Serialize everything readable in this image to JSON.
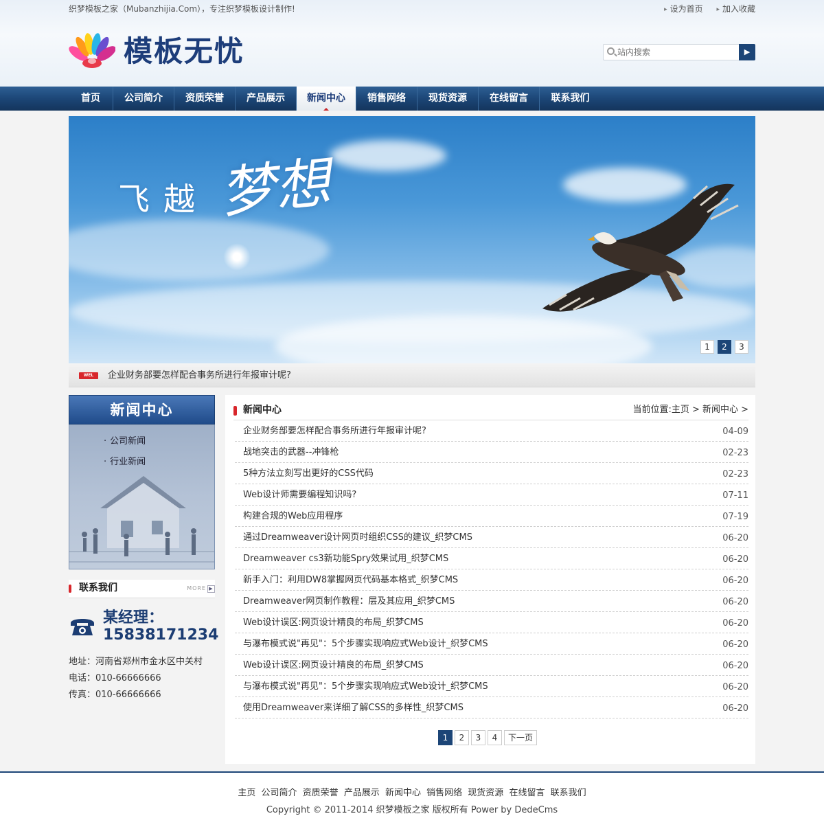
{
  "topbar": {
    "slogan": "织梦模板之家（Mubanzhijia.Com），专注织梦模板设计制作!",
    "links": [
      "设为首页",
      "加入收藏"
    ]
  },
  "logo": {
    "text": "模板无忧"
  },
  "search": {
    "placeholder": "站内搜索"
  },
  "nav": {
    "items": [
      "首页",
      "公司简介",
      "资质荣誉",
      "产品展示",
      "新闻中心",
      "销售网络",
      "现货资源",
      "在线留言",
      "联系我们"
    ],
    "active": "新闻中心"
  },
  "banner": {
    "title1": "飞越",
    "title2": "梦想",
    "slides": [
      "1",
      "2",
      "3"
    ],
    "active_slide": "2"
  },
  "ticker": {
    "badge": "WEL",
    "text": "企业财务部要怎样配合事务所进行年报审计呢?"
  },
  "sidebar": {
    "title": "新闻中心",
    "items": [
      "公司新闻",
      "行业新闻"
    ]
  },
  "contact": {
    "title": "联系我们",
    "more": "MORE",
    "manager": "某经理：",
    "phone": "15838171234",
    "address": "地址：河南省郑州市金水区中关村",
    "tel": "电话：010-66666666",
    "fax": "传真：010-66666666"
  },
  "main": {
    "title": "新闻中心",
    "breadcrumb": "当前位置:主页 > 新闻中心 >",
    "news": [
      {
        "title": "企业财务部要怎样配合事务所进行年报审计呢?",
        "date": "04-09"
      },
      {
        "title": "战地突击的武器--冲锋枪",
        "date": "02-23"
      },
      {
        "title": "5种方法立刻写出更好的CSS代码",
        "date": "02-23"
      },
      {
        "title": "Web设计师需要编程知识吗?",
        "date": "07-11"
      },
      {
        "title": "构建合规的Web应用程序",
        "date": "07-19"
      },
      {
        "title": "通过Dreamweaver设计网页时组织CSS的建议_织梦CMS",
        "date": "06-20"
      },
      {
        "title": "Dreamweaver cs3新功能Spry效果试用_织梦CMS",
        "date": "06-20"
      },
      {
        "title": "新手入门：利用DW8掌握网页代码基本格式_织梦CMS",
        "date": "06-20"
      },
      {
        "title": "Dreamweaver网页制作教程：层及其应用_织梦CMS",
        "date": "06-20"
      },
      {
        "title": "Web设计误区:网页设计精良的布局_织梦CMS",
        "date": "06-20"
      },
      {
        "title": "与瀑布模式说\"再见\"：5个步骤实现响应式Web设计_织梦CMS",
        "date": "06-20"
      },
      {
        "title": "Web设计误区:网页设计精良的布局_织梦CMS",
        "date": "06-20"
      },
      {
        "title": "与瀑布模式说\"再见\"：5个步骤实现响应式Web设计_织梦CMS",
        "date": "06-20"
      },
      {
        "title": "使用Dreamweaver来详细了解CSS的多样性_织梦CMS",
        "date": "06-20"
      }
    ],
    "pager": [
      "1",
      "2",
      "3",
      "4",
      "下一页"
    ],
    "pager_active": "1"
  },
  "footer": {
    "links": [
      "主页",
      "公司简介",
      "资质荣誉",
      "产品展示",
      "新闻中心",
      "销售网络",
      "现货资源",
      "在线留言",
      "联系我们"
    ],
    "copyright": "Copyright © 2011-2014 织梦模板之家 版权所有 Power by DedeCms"
  },
  "colors": {
    "nav_blue": "#1b4474",
    "accent_red": "#d8262b",
    "brand_dark_blue": "#1d3d7a"
  }
}
